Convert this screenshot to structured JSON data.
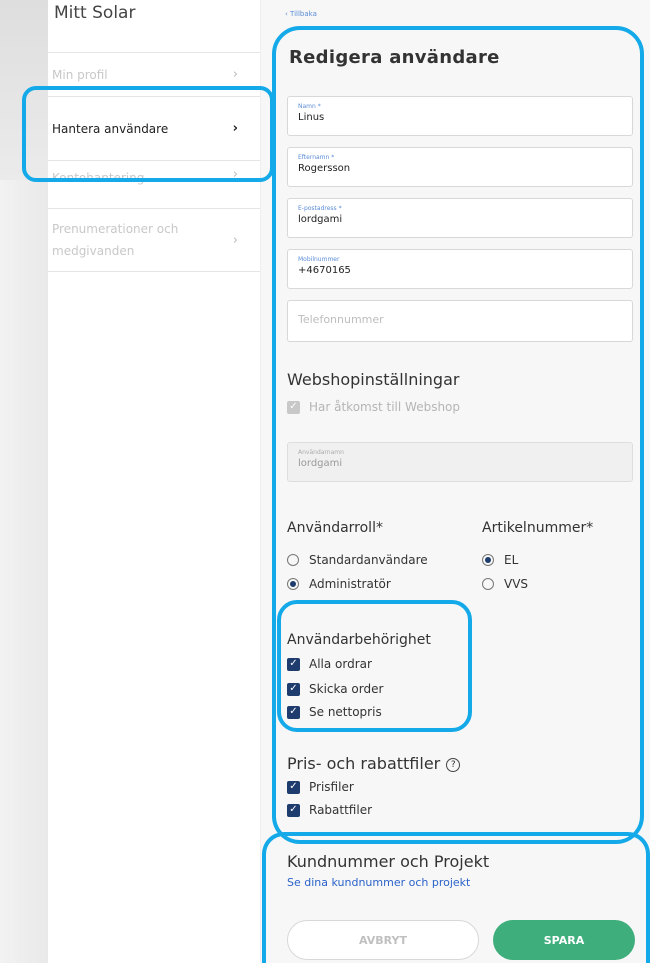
{
  "sidebar": {
    "title": "Mitt Solar",
    "items": [
      {
        "label": "Min profil",
        "chevron": "›"
      },
      {
        "label": "Hantera användare",
        "chevron": "›"
      },
      {
        "label": "Kontohantering",
        "chevron": "›"
      },
      {
        "label": "Prenumerationer och medgivanden",
        "chevron": "›"
      }
    ]
  },
  "form": {
    "back_link": "‹ Tillbaka",
    "heading": "Redigera användare",
    "fields": {
      "first_name": {
        "label": "Namn *",
        "value": "Linus"
      },
      "last_name": {
        "label": "Efternamn *",
        "value": "Rogersson"
      },
      "email": {
        "label": "E-postadress *",
        "value": "lordgami"
      },
      "mobile": {
        "label": "Mobilnummer",
        "value": "+4670165"
      },
      "phone": {
        "placeholder": "Telefonnummer"
      }
    },
    "webshop": {
      "title": "Webshopinställningar",
      "access_label": "Har åtkomst till Webshop",
      "access_checked": true,
      "username": {
        "label": "Användarnamn",
        "value": "lordgami"
      }
    },
    "role": {
      "title": "Användarroll*",
      "options": [
        {
          "label": "Standardanvändare",
          "selected": false
        },
        {
          "label": "Administratör",
          "selected": true
        }
      ]
    },
    "article": {
      "title": "Artikelnummer*",
      "options": [
        {
          "label": "EL",
          "selected": true
        },
        {
          "label": "VVS",
          "selected": false
        }
      ]
    },
    "permissions": {
      "title": "Användarbehörighet",
      "items": [
        {
          "label": "Alla ordrar",
          "checked": true
        },
        {
          "label": "Skicka order",
          "checked": true
        },
        {
          "label": "Se nettopris",
          "checked": true
        }
      ]
    },
    "price_files": {
      "title": "Pris- och rabattfiler",
      "help_icon": "question-circle-icon",
      "items": [
        {
          "label": "Prisfiler",
          "checked": true
        },
        {
          "label": "Rabattfiler",
          "checked": true
        }
      ]
    },
    "customer": {
      "title": "Kundnummer och Projekt",
      "link": "Se dina kundnummer och projekt"
    },
    "buttons": {
      "cancel": "AVBRYT",
      "save": "SPARA"
    }
  },
  "colors": {
    "highlight": "#14a9e8",
    "save_button": "#3fae7d",
    "link": "#2a62c9",
    "checkbox": "#1e3c6e"
  }
}
